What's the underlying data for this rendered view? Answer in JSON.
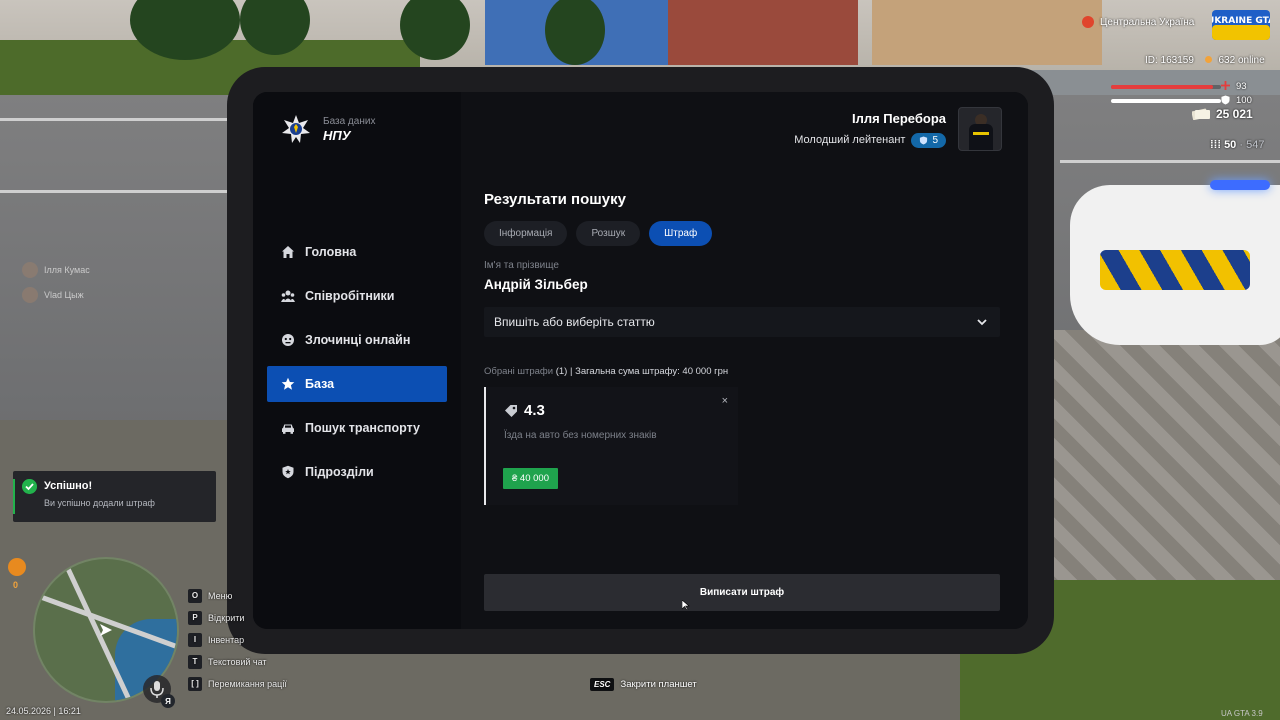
{
  "tablet": {
    "brand": {
      "subtitle": "База даних",
      "title": "НПУ"
    },
    "nav": [
      {
        "label": "Головна",
        "icon": "home-icon",
        "active": false
      },
      {
        "label": "Співробітники",
        "icon": "users-icon",
        "active": false
      },
      {
        "label": "Злочинці онлайн",
        "icon": "mask-icon",
        "active": false
      },
      {
        "label": "База",
        "icon": "star-icon",
        "active": true
      },
      {
        "label": "Пошук транспорту",
        "icon": "car-icon",
        "active": false
      },
      {
        "label": "Підрозділи",
        "icon": "shield-icon",
        "active": false
      }
    ],
    "user": {
      "name": "Ілля Перебора",
      "rank": "Молодший лейтенант",
      "level": "5"
    },
    "main": {
      "heading": "Результати пошуку",
      "tabs": [
        {
          "label": "Інформація",
          "active": false
        },
        {
          "label": "Розшук",
          "active": false
        },
        {
          "label": "Штраф",
          "active": true
        }
      ],
      "field_label": "Ім'я та прізвище",
      "person_name": "Андрій Зільбер",
      "article_select_placeholder": "Впишіть або виберіть статтю",
      "summary": {
        "label": "Обрані штрафи",
        "count": "(1)",
        "total_text": "| Загальна сума штрафу: 40 000 грн"
      },
      "fine": {
        "code": "4.3",
        "description": "Їзда на авто без номерних знаків",
        "amount": "₴ 40 000",
        "close": "×"
      },
      "submit_label": "Виписати штраф"
    }
  },
  "hud": {
    "region": "Центральна Україна",
    "logo_text": "UKRAINE GTA",
    "id_text": "ID: 163159",
    "online_text": "632 online",
    "health": "93",
    "armor": "100",
    "health_fraction": 0.93,
    "armor_fraction": 1.0,
    "money": "25 021",
    "ammo_current": "50",
    "ammo_total": "547",
    "players": [
      "Ілля Кумас",
      "Vlad Цыж"
    ],
    "toast": {
      "title": "Успішно!",
      "text": "Ви успішно додали штраф"
    },
    "minimap_counter": "0",
    "lang": "Я",
    "datetime": "24.05.2026 | 16:21",
    "keys": [
      {
        "key": "O",
        "label": "Меню"
      },
      {
        "key": "P",
        "label": "Відкрити"
      },
      {
        "key": "I",
        "label": "Інвентар"
      },
      {
        "key": "T",
        "label": "Текстовий чат"
      },
      {
        "key": "[ ]",
        "label": "Перемикання рації"
      }
    ],
    "esc": {
      "key": "ESC",
      "label": "Закрити планшет"
    },
    "version": "UA GTA 3.9"
  },
  "colors": {
    "accent": "#0c4fb3",
    "success": "#1fa34d",
    "health": "#e53d3d",
    "armor": "#ffffff"
  }
}
